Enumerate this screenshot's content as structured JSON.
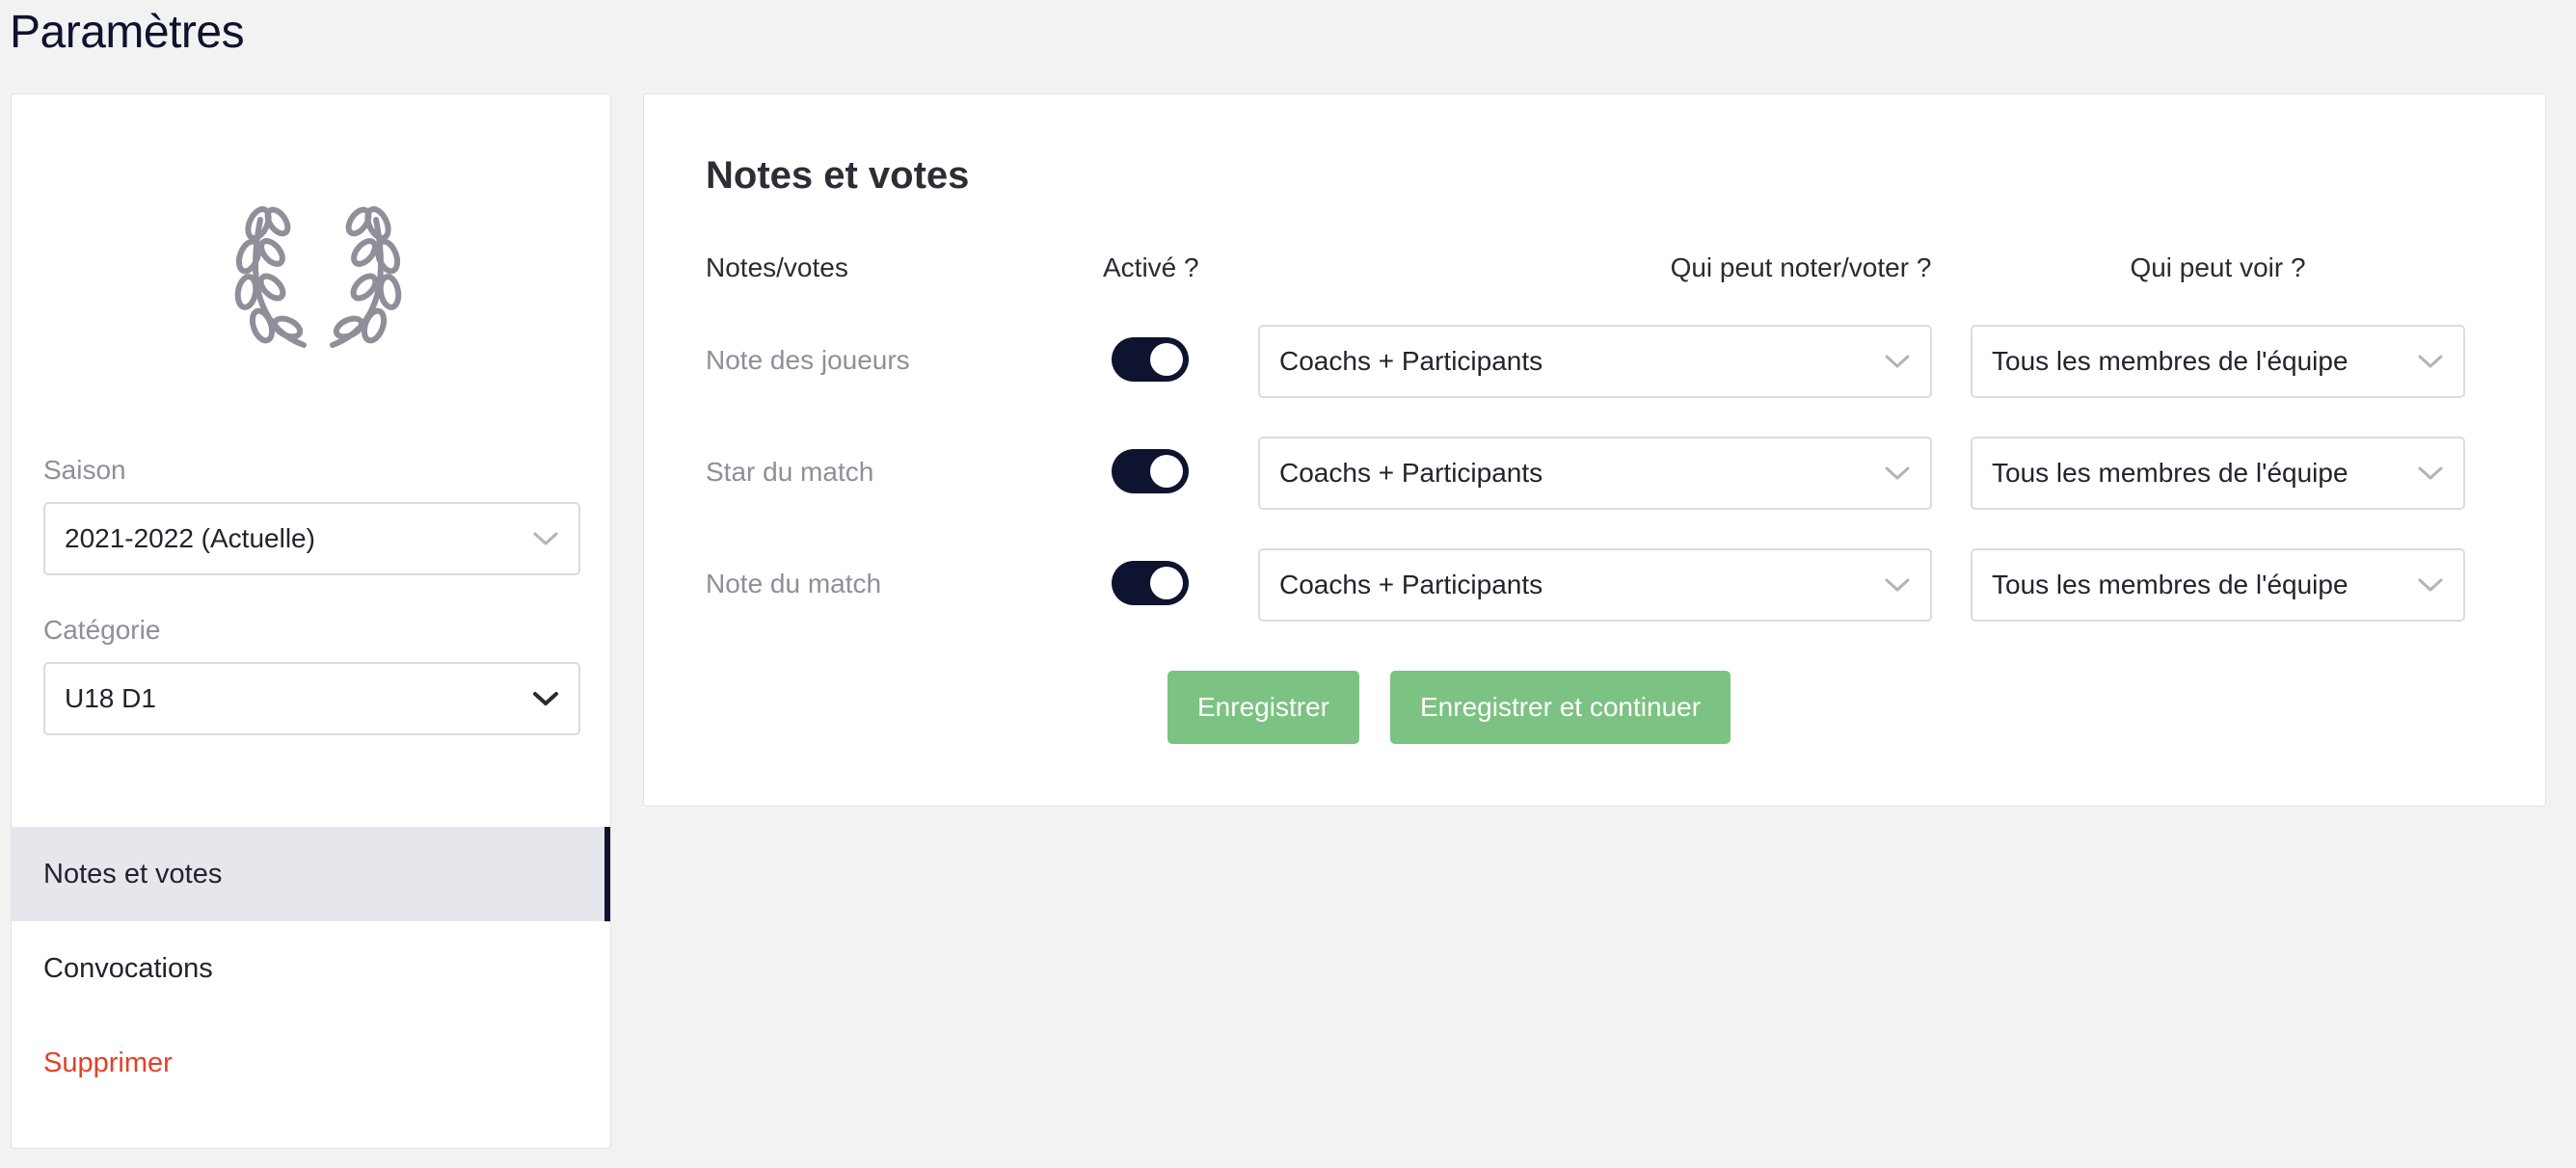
{
  "page": {
    "title": "Paramètres"
  },
  "sidebar": {
    "season": {
      "label": "Saison",
      "value": "2021-2022 (Actuelle)"
    },
    "category": {
      "label": "Catégorie",
      "value": "U18 D1"
    },
    "nav": [
      {
        "label": "Notes et votes",
        "active": true
      },
      {
        "label": "Convocations",
        "active": false
      },
      {
        "label": "Supprimer",
        "active": false
      }
    ]
  },
  "main": {
    "title": "Notes et votes",
    "headers": {
      "type": "Notes/votes",
      "enabled": "Activé ?",
      "who_votes": "Qui peut noter/voter ?",
      "who_sees": "Qui peut voir ?"
    },
    "rows": [
      {
        "label": "Note des joueurs",
        "enabled": true,
        "who_votes": "Coachs + Participants",
        "who_sees": "Tous les membres de l'équipe"
      },
      {
        "label": "Star du match",
        "enabled": true,
        "who_votes": "Coachs + Participants",
        "who_sees": "Tous les membres de l'équipe"
      },
      {
        "label": "Note du match",
        "enabled": true,
        "who_votes": "Coachs + Participants",
        "who_sees": "Tous les membres de l'équipe"
      }
    ],
    "buttons": {
      "save": "Enregistrer",
      "save_continue": "Enregistrer et continuer"
    }
  },
  "colors": {
    "accent": "#0e1330",
    "button": "#7cc282",
    "danger": "#e2412a",
    "muted_text": "#8e8f99"
  },
  "icons": {
    "emblem": "laurel-wreath-icon",
    "dropdown": "chevron-down-icon"
  }
}
